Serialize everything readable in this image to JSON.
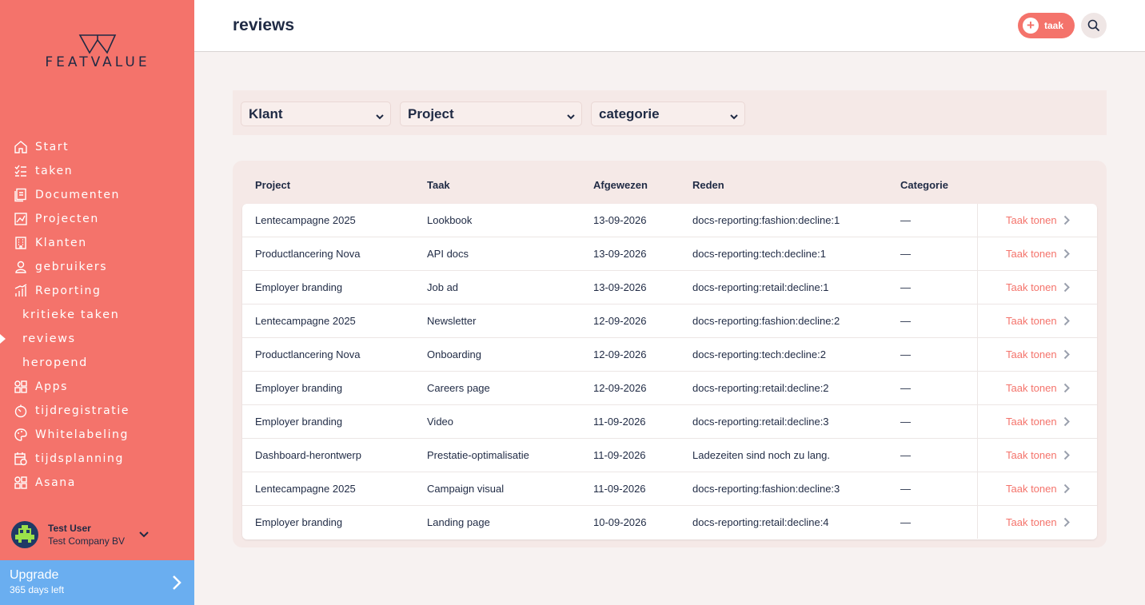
{
  "sidebar": {
    "logo_text": "FEATVALUE",
    "items": [
      {
        "label": "Start",
        "icon": "home-icon"
      },
      {
        "label": "taken",
        "icon": "checklist-icon"
      },
      {
        "label": "Documenten",
        "icon": "documents-icon"
      },
      {
        "label": "Projecten",
        "icon": "chart-icon"
      },
      {
        "label": "Klanten",
        "icon": "building-icon"
      },
      {
        "label": "gebruikers",
        "icon": "user-icon"
      },
      {
        "label": "Reporting",
        "icon": "bar-chart-icon"
      },
      {
        "label": "kritieke taken",
        "sub": true
      },
      {
        "label": "reviews",
        "sub": true,
        "active": true
      },
      {
        "label": "heropend",
        "sub": true
      },
      {
        "label": "Apps",
        "icon": "apps-icon"
      },
      {
        "label": "tijdregistratie",
        "icon": "timer-icon"
      },
      {
        "label": "Whitelabeling",
        "icon": "palette-icon"
      },
      {
        "label": "tijdsplanning",
        "icon": "calendar-clock-icon"
      },
      {
        "label": "Asana",
        "icon": "apps-icon"
      }
    ],
    "user": {
      "name": "Test User",
      "company": "Test Company BV"
    },
    "upgrade": {
      "title": "Upgrade",
      "subtitle": "365 days left"
    }
  },
  "header": {
    "title": "reviews",
    "add_task_label": "taak"
  },
  "filters": {
    "klant": "Klant",
    "project": "Project",
    "categorie": "categorie"
  },
  "table": {
    "headers": {
      "project": "Project",
      "taak": "Taak",
      "afgewezen": "Afgewezen",
      "reden": "Reden",
      "categorie": "Categorie"
    },
    "action_label": "Taak tonen",
    "rows": [
      {
        "project": "Lentecampagne 2025",
        "taak": "Lookbook",
        "afgewezen": "13-09-2026",
        "reden": "docs-reporting:fashion:decline:1",
        "categorie": "—"
      },
      {
        "project": "Productlancering Nova",
        "taak": "API docs",
        "afgewezen": "13-09-2026",
        "reden": "docs-reporting:tech:decline:1",
        "categorie": "—"
      },
      {
        "project": "Employer branding",
        "taak": "Job ad",
        "afgewezen": "13-09-2026",
        "reden": "docs-reporting:retail:decline:1",
        "categorie": "—"
      },
      {
        "project": "Lentecampagne 2025",
        "taak": "Newsletter",
        "afgewezen": "12-09-2026",
        "reden": "docs-reporting:fashion:decline:2",
        "categorie": "—"
      },
      {
        "project": "Productlancering Nova",
        "taak": "Onboarding",
        "afgewezen": "12-09-2026",
        "reden": "docs-reporting:tech:decline:2",
        "categorie": "—"
      },
      {
        "project": "Employer branding",
        "taak": "Careers page",
        "afgewezen": "12-09-2026",
        "reden": "docs-reporting:retail:decline:2",
        "categorie": "—"
      },
      {
        "project": "Employer branding",
        "taak": "Video",
        "afgewezen": "11-09-2026",
        "reden": "docs-reporting:retail:decline:3",
        "categorie": "—"
      },
      {
        "project": "Dashboard-herontwerp",
        "taak": "Prestatie-optimalisatie",
        "afgewezen": "11-09-2026",
        "reden": "Ladezeiten sind noch zu lang.",
        "categorie": "—"
      },
      {
        "project": "Lentecampagne 2025",
        "taak": "Campaign visual",
        "afgewezen": "11-09-2026",
        "reden": "docs-reporting:fashion:decline:3",
        "categorie": "—"
      },
      {
        "project": "Employer branding",
        "taak": "Landing page",
        "afgewezen": "10-09-2026",
        "reden": "docs-reporting:retail:decline:4",
        "categorie": "—"
      }
    ]
  },
  "colors": {
    "accent": "#f4736b",
    "navy": "#1f2a44",
    "upgrade": "#6aaef0"
  }
}
